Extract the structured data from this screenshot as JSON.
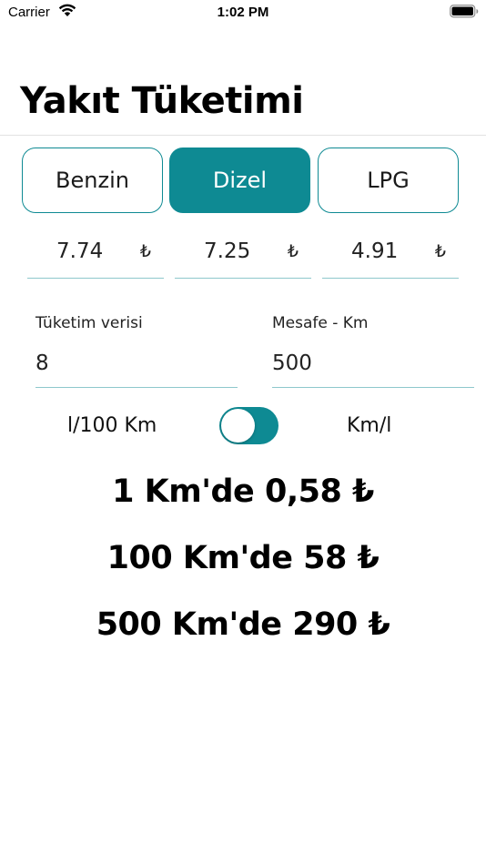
{
  "status_bar": {
    "carrier": "Carrier",
    "time": "1:02 PM"
  },
  "page_title": "Yakıt Tüketimi",
  "fuel_types": [
    {
      "label": "Benzin",
      "selected": false
    },
    {
      "label": "Dizel",
      "selected": true
    },
    {
      "label": "LPG",
      "selected": false
    }
  ],
  "prices": [
    {
      "value": "7.74",
      "currency": "₺"
    },
    {
      "value": "7.25",
      "currency": "₺"
    },
    {
      "value": "4.91",
      "currency": "₺"
    }
  ],
  "consumption": {
    "label": "Tüketim verisi",
    "value": "8"
  },
  "distance": {
    "label": "Mesafe - Km",
    "value": "500"
  },
  "unit_toggle": {
    "left_label": "l/100 Km",
    "right_label": "Km/l",
    "on": true
  },
  "results": [
    "1 Km'de 0,58 ₺",
    "100 Km'de 58 ₺",
    "500 Km'de 290 ₺"
  ],
  "colors": {
    "accent": "#0e8a93",
    "underline": "#8ec8cc"
  }
}
